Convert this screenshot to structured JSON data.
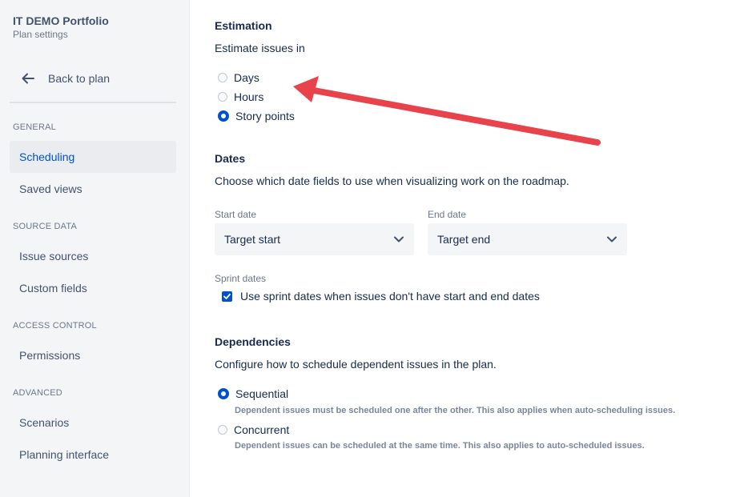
{
  "sidebar": {
    "project_title": "IT DEMO Portfolio",
    "project_subtitle": "Plan settings",
    "back_label": "Back to plan",
    "sections": {
      "general": "GENERAL",
      "source_data": "SOURCE DATA",
      "access_control": "ACCESS CONTROL",
      "advanced": "ADVANCED"
    },
    "items": {
      "scheduling": "Scheduling",
      "saved_views": "Saved views",
      "issue_sources": "Issue sources",
      "custom_fields": "Custom fields",
      "permissions": "Permissions",
      "scenarios": "Scenarios",
      "planning_interface": "Planning interface"
    },
    "active_item": "Scheduling"
  },
  "estimation": {
    "heading": "Estimation",
    "label": "Estimate issues in",
    "options": [
      "Days",
      "Hours",
      "Story points"
    ],
    "selected": "Story points"
  },
  "dates": {
    "heading": "Dates",
    "description": "Choose which date fields to use when visualizing work on the roadmap.",
    "start_label": "Start date",
    "start_value": "Target start",
    "end_label": "End date",
    "end_value": "Target end",
    "sprint_label": "Sprint dates",
    "sprint_checkbox_label": "Use sprint dates when issues don't have start and end dates",
    "sprint_checked": true
  },
  "dependencies": {
    "heading": "Dependencies",
    "description": "Configure how to schedule dependent issues in the plan.",
    "options": [
      {
        "label": "Sequential",
        "desc": "Dependent issues must be scheduled one after the other. This also applies when auto-scheduling issues."
      },
      {
        "label": "Concurrent",
        "desc": "Dependent issues can be scheduled at the same time. This also applies to auto-scheduled issues."
      }
    ],
    "selected": "Sequential"
  },
  "colors": {
    "accent": "#0052cc",
    "annotation_arrow": "#e8424a"
  },
  "icons": [
    "arrow-left-icon",
    "chevron-down-icon",
    "checkmark-icon"
  ]
}
